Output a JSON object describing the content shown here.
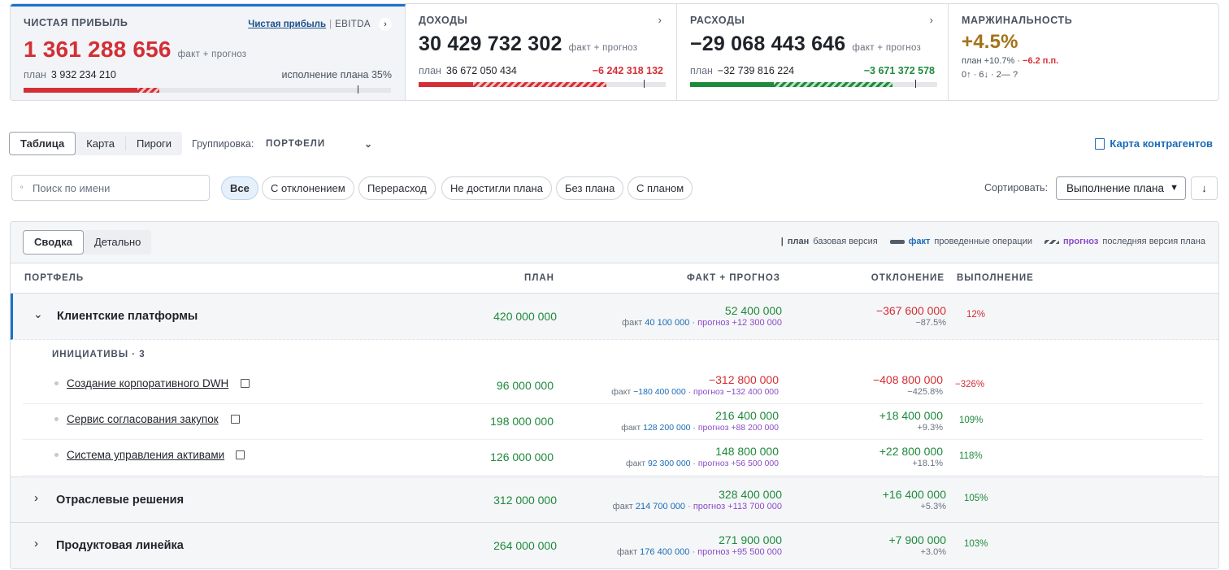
{
  "kpi": {
    "net": {
      "title": "ЧИСТАЯ ПРИБЫЛЬ",
      "toggle_active": "Чистая прибыль",
      "toggle_sep": "|",
      "toggle_other": "EBITDA",
      "value": "1 361 288 656",
      "suffix": "факт + прогноз",
      "plan_label": "план",
      "plan": "3 932 234 210",
      "exec": "исполнение плана 35%",
      "progress": 0.35
    },
    "income": {
      "title": "ДОХОДЫ",
      "value": "30 429 732 302",
      "suffix": "факт + прогноз",
      "plan_label": "план",
      "plan": "36 672 050 434",
      "delta": "−6 242 318 132",
      "progress": 0.83
    },
    "expense": {
      "title": "РАСХОДЫ",
      "value": "−29 068 443 646",
      "suffix": "факт + прогноз",
      "plan_label": "план",
      "plan": "−32 739 816 224",
      "delta": "−3 671 372 578",
      "progress": 0.89
    },
    "margin": {
      "title": "МАРЖИНАЛЬНОСТЬ",
      "value": "+4.5%",
      "plan_text": "план +10.7% ·",
      "delta": "−6.2 п.п.",
      "counts": "0↑ · 6↓ · 2— ?"
    }
  },
  "toolbar": {
    "tabs": [
      "Таблица",
      "Карта",
      "Пироги"
    ],
    "group_label": "Группировка:",
    "group_value": "ПОРТФЕЛИ",
    "map_btn": "Карта контрагентов"
  },
  "filters": {
    "search_placeholder": "Поиск по имени",
    "pills": [
      "Все",
      "С отклонением",
      "Перерасход",
      "Не достигли плана",
      "Без плана",
      "С планом"
    ],
    "sort_label": "Сортировать:",
    "sort_value": "Выполнение плана"
  },
  "panel": {
    "tabs": [
      "Сводка",
      "Детально"
    ],
    "legend": {
      "plan_b": "план",
      "plan_t": "базовая версия",
      "fact_b": "факт",
      "fact_t": "проведенные операции",
      "forecast_b": "прогноз",
      "forecast_t": "последняя версия плана"
    }
  },
  "table": {
    "headers": [
      "ПОРТФЕЛЬ",
      "ПЛАН",
      "ФАКТ + ПРОГНОЗ",
      "ОТКЛОНЕНИЕ",
      "ВЫПОЛНЕНИЕ"
    ],
    "fact_label": "факт",
    "forecast_label": "прогноз",
    "group1": {
      "name": "Клиентские платформы",
      "plan": "420 000 000",
      "total": "52 400 000",
      "fact": "40 100 000",
      "forecast": "+12 300 000",
      "dev": "−367 600 000",
      "devp": "−87.5%",
      "exec": "12%"
    },
    "initiatives_label": "ИНИЦИАТИВЫ · 3",
    "items": [
      {
        "name": "Создание корпоративного DWH",
        "plan": "96 000 000",
        "total": "−312 800 000",
        "fact": "−180 400 000",
        "forecast": "−132 400 000",
        "dev": "−408 800 000",
        "devp": "−425.8%",
        "exec": "−326%"
      },
      {
        "name": "Сервис согласования закупок",
        "plan": "198 000 000",
        "total": "216 400 000",
        "fact": "128 200 000",
        "forecast": "+88 200 000",
        "dev": "+18 400 000",
        "devp": "+9.3%",
        "exec": "109%"
      },
      {
        "name": "Система управления активами",
        "plan": "126 000 000",
        "total": "148 800 000",
        "fact": "92 300 000",
        "forecast": "+56 500 000",
        "dev": "+22 800 000",
        "devp": "+18.1%",
        "exec": "118%"
      }
    ],
    "group2": {
      "name": "Отраслевые решения",
      "plan": "312 000 000",
      "total": "328 400 000",
      "fact": "214 700 000",
      "forecast": "+113 700 000",
      "dev": "+16 400 000",
      "devp": "+5.3%",
      "exec": "105%"
    },
    "group3": {
      "name": "Продуктовая линейка",
      "plan": "264 000 000",
      "total": "271 900 000",
      "fact": "176 400 000",
      "forecast": "+95 500 000",
      "dev": "+7 900 000",
      "devp": "+3.0%",
      "exec": "103%"
    }
  }
}
